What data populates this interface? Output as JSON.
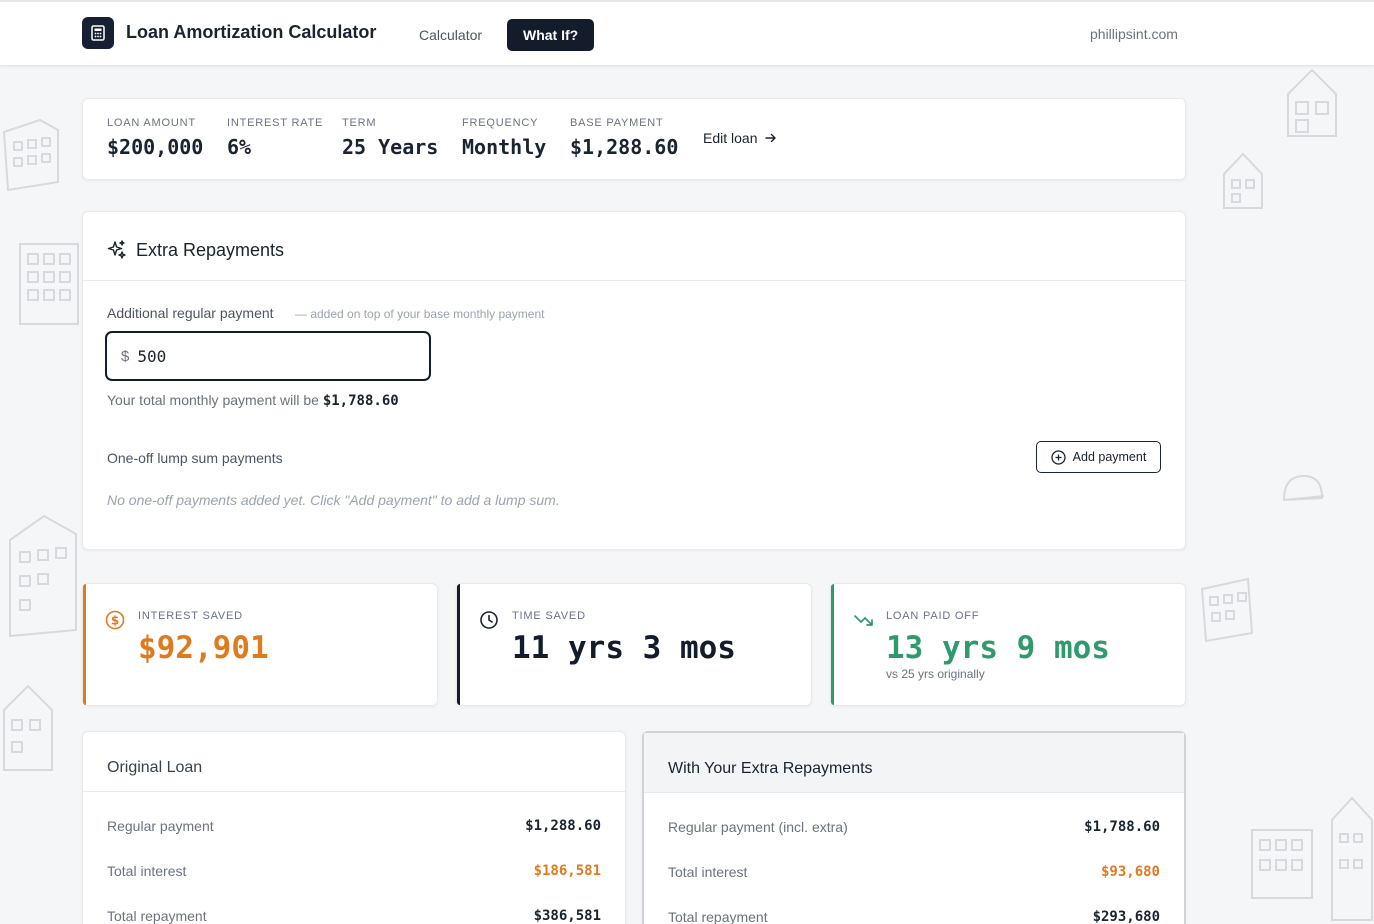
{
  "header": {
    "title": "Loan Amortization Calculator",
    "nav": {
      "calculator": "Calculator",
      "what_if": "What If?"
    },
    "site": "phillipsint.com"
  },
  "loan_summary": {
    "loan_amount": {
      "label": "LOAN AMOUNT",
      "value": "$200,000"
    },
    "interest_rate": {
      "label": "INTEREST RATE",
      "value": "6%"
    },
    "term": {
      "label": "TERM",
      "value": "25 Years"
    },
    "frequency": {
      "label": "FREQUENCY",
      "value": "Monthly"
    },
    "base_payment": {
      "label": "BASE PAYMENT",
      "value": "$1,288.60"
    },
    "edit_label": "Edit loan"
  },
  "extra_repayments": {
    "title": "Extra Repayments",
    "regular_label": "Additional regular payment",
    "regular_hint": "— added on top of your base monthly payment",
    "currency_symbol": "$",
    "regular_value": "500",
    "total_note_prefix": "Your total monthly payment will be",
    "total_note_value": "$1,788.60",
    "lump_label": "One-off lump sum payments",
    "add_button": "Add payment",
    "empty_note": "No one-off payments added yet. Click \"Add payment\" to add a lump sum."
  },
  "stats": {
    "interest_saved": {
      "label": "INTEREST SAVED",
      "value": "$92,901",
      "color": "#e07a1f"
    },
    "time_saved": {
      "label": "TIME SAVED",
      "value": "11 yrs 3 mos",
      "color": "#141c2c"
    },
    "loan_paid_off": {
      "label": "LOAN PAID OFF",
      "value": "13 yrs 9 mos",
      "sub": "vs 25 yrs originally",
      "color": "#2f9a6c"
    }
  },
  "original": {
    "title": "Original Loan",
    "rows": [
      {
        "label": "Regular payment",
        "value": "$1,288.60"
      },
      {
        "label": "Total interest",
        "value": "$186,581"
      },
      {
        "label": "Total repayment",
        "value": "$386,581"
      }
    ]
  },
  "with_extra": {
    "title": "With Your Extra Repayments",
    "rows": [
      {
        "label": "Regular payment (incl. extra)",
        "value": "$1,788.60"
      },
      {
        "label": "Total interest",
        "value": "$93,680"
      },
      {
        "label": "Total repayment",
        "value": "$293,680"
      }
    ]
  }
}
